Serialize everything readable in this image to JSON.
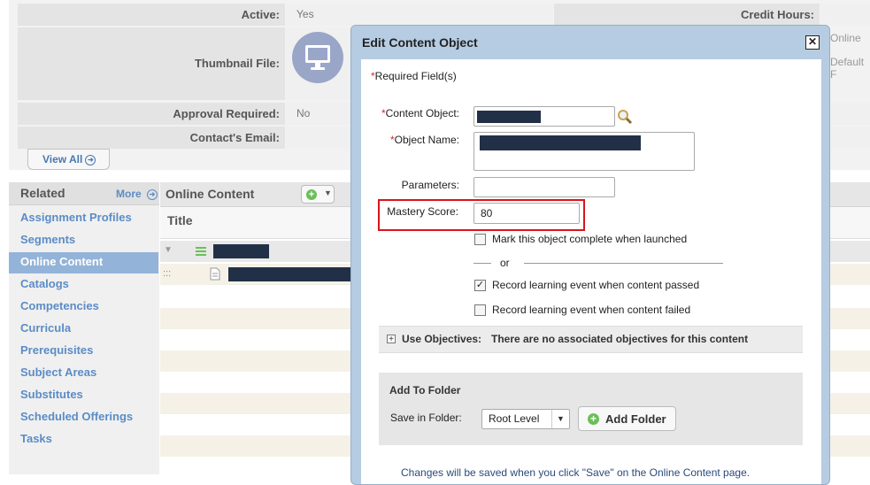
{
  "details": {
    "active_label": "Active:",
    "active_value": "Yes",
    "credit_hours_label": "Credit Hours:",
    "thumbnail_label": "Thumbnail File:",
    "online_partial": "Online",
    "default_partial": "Default F",
    "approval_label": "Approval Required:",
    "approval_value": "No",
    "contact_label": "Contact's Email:",
    "view_all": "View All"
  },
  "related": {
    "header": "Related",
    "more": "More",
    "items": [
      {
        "label": "Assignment Profiles"
      },
      {
        "label": "Segments"
      },
      {
        "label": "Online Content"
      },
      {
        "label": "Catalogs"
      },
      {
        "label": "Competencies"
      },
      {
        "label": "Curricula"
      },
      {
        "label": "Prerequisites"
      },
      {
        "label": "Subject Areas"
      },
      {
        "label": "Substitutes"
      },
      {
        "label": "Scheduled Offerings"
      },
      {
        "label": "Tasks"
      }
    ],
    "selected": "Online Content"
  },
  "grid": {
    "title": "Online Content",
    "column_title": "Title",
    "drag_handle": ":::"
  },
  "dialog": {
    "title": "Edit Content Object",
    "required_note": "Required Field(s)",
    "required_star": "*",
    "content_object_label": "Content Object:",
    "object_name_label": "Object Name:",
    "parameters_label": "Parameters:",
    "parameters_value": "",
    "mastery_label": "Mastery Score:",
    "mastery_value": "80",
    "chk_complete_label": "Mark this object complete when launched",
    "chk_complete": false,
    "or_text": "or",
    "chk_passed_label": "Record learning event when content passed",
    "chk_passed": true,
    "chk_failed_label": "Record learning event when content failed",
    "chk_failed": false,
    "objectives_label": "Use Objectives:",
    "objectives_text": "There are no associated objectives for this content",
    "folder_header": "Add To Folder",
    "save_in_folder_label": "Save in Folder:",
    "folder_value": "Root Level",
    "add_folder_button": "Add Folder",
    "footer_note": "Changes will be saved when you click \"Save\" on the Online Content page."
  },
  "colors": {
    "link": "#5b8cc6",
    "selected_nav": "#94b3d8",
    "dialog_frame": "#b6cce2",
    "highlight_box": "#d9151b",
    "redaction": "#223047"
  }
}
